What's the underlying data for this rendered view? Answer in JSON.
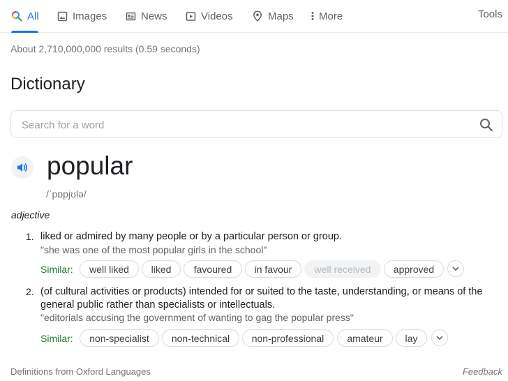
{
  "tabs": [
    {
      "label": "All",
      "icon": "search-icon"
    },
    {
      "label": "Images",
      "icon": "image-icon"
    },
    {
      "label": "News",
      "icon": "news-icon"
    },
    {
      "label": "Videos",
      "icon": "video-icon"
    },
    {
      "label": "Maps",
      "icon": "map-pin-icon"
    },
    {
      "label": "More",
      "icon": "more-vert-icon"
    }
  ],
  "tools_label": "Tools",
  "result_stats": "About 2,710,000,000 results (0.59 seconds)",
  "dictionary": {
    "title": "Dictionary",
    "search_placeholder": "Search for a word",
    "word": "popular",
    "phonetic": "/ˈpɒpjʊlə/",
    "part_of_speech": "adjective",
    "definitions": [
      {
        "number": "1.",
        "text": "liked or admired by many people or by a particular person or group.",
        "example": "\"she was one of the most popular girls in the school\"",
        "similar_label": "Similar:",
        "similar": [
          "well liked",
          "liked",
          "favoured",
          "in favour",
          "well received",
          "approved"
        ]
      },
      {
        "number": "2.",
        "text_line1": "(of cultural activities or products) intended for or suited to the taste, understanding, or means of the",
        "text_line2": "general public rather than specialists or intellectuals.",
        "example": "\"editorials accusing the government of wanting to gag the popular press\"",
        "similar_label": "Similar:",
        "similar": [
          "non-specialist",
          "non-technical",
          "non-professional",
          "amateur",
          "lay"
        ]
      }
    ],
    "source": "Definitions from Oxford Languages",
    "feedback": "Feedback"
  },
  "colors": {
    "accent": "#1a73e8",
    "similar_green": "#188038",
    "muted_text": "#70757a"
  }
}
